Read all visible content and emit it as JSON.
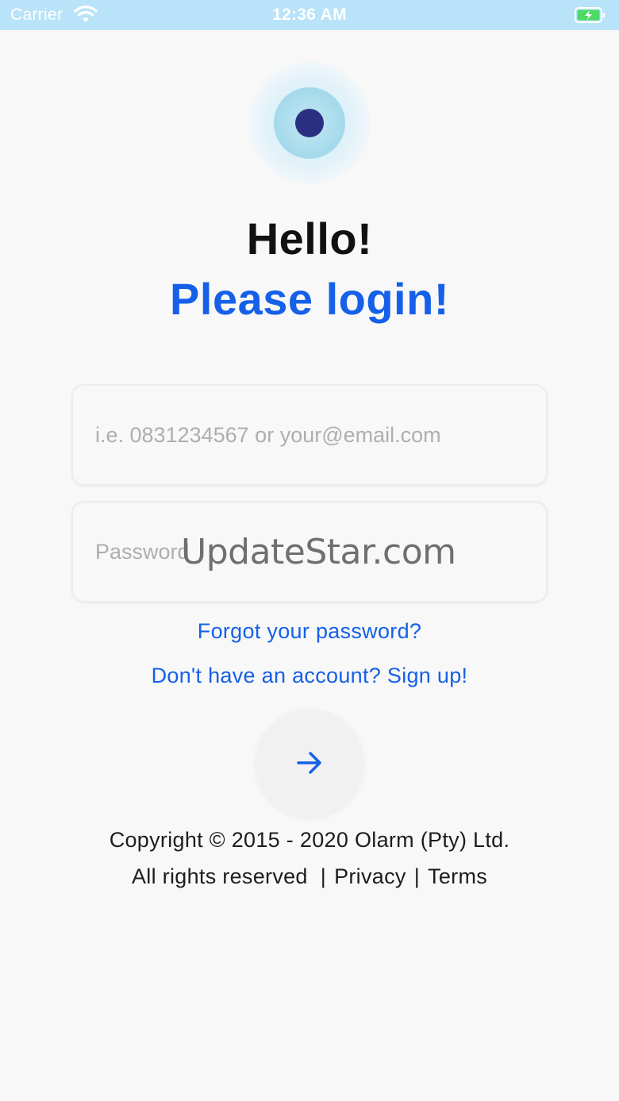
{
  "status_bar": {
    "carrier": "Carrier",
    "time": "12:36 AM",
    "wifi_icon": "wifi-icon",
    "battery_icon": "battery-charging-icon"
  },
  "logo": {
    "icon": "eye-target-logo",
    "colors": [
      "#e3f3fa",
      "#a7dcec",
      "#2b2f82"
    ]
  },
  "heading": {
    "greeting": "Hello!",
    "prompt": "Please login!"
  },
  "form": {
    "identity_placeholder": "i.e. 0831234567 or your@email.com",
    "identity_value": "",
    "password_placeholder": "Password",
    "password_value": ""
  },
  "links": {
    "forgot_password": "Forgot your password?",
    "sign_up": "Don't have an account? Sign up!"
  },
  "submit": {
    "icon": "arrow-right-icon"
  },
  "watermark": "UpdateStar.com",
  "footer": {
    "copyright": "Copyright © 2015 - 2020 Olarm (Pty) Ltd.",
    "rights": "All rights reserved",
    "separator": "|",
    "privacy": "Privacy",
    "terms": "Terms"
  },
  "colors": {
    "accent": "#1560e8",
    "status_bar": "#b9e3f8",
    "battery": "#4cd964",
    "background": "#f8f8f8"
  }
}
